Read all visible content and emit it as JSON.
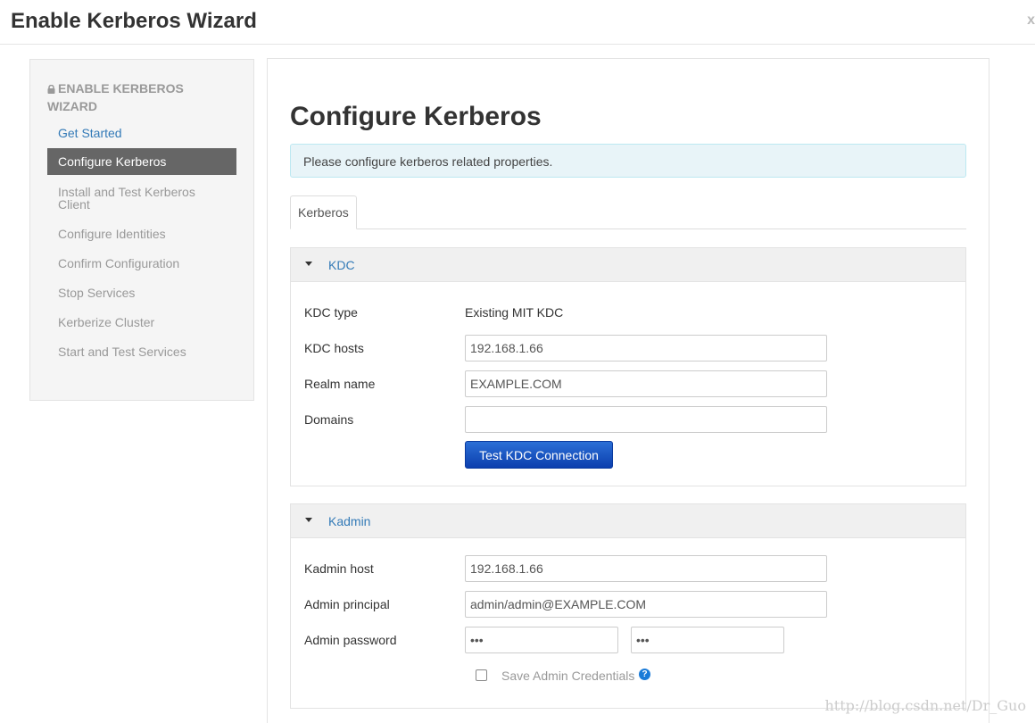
{
  "modal": {
    "title": "Enable Kerberos Wizard",
    "close_label": "x"
  },
  "sidebar": {
    "header": "ENABLE KERBEROS WIZARD",
    "items": [
      {
        "label": "Get Started",
        "state": "link"
      },
      {
        "label": "Configure Kerberos",
        "state": "active"
      },
      {
        "label": "Install and Test Kerberos Client",
        "state": "disabled"
      },
      {
        "label": "Configure Identities",
        "state": "disabled"
      },
      {
        "label": "Confirm Configuration",
        "state": "disabled"
      },
      {
        "label": "Stop Services",
        "state": "disabled"
      },
      {
        "label": "Kerberize Cluster",
        "state": "disabled"
      },
      {
        "label": "Start and Test Services",
        "state": "disabled"
      }
    ]
  },
  "main": {
    "title": "Configure Kerberos",
    "alert": "Please configure kerberos related properties.",
    "tabs": [
      {
        "label": "Kerberos"
      }
    ],
    "kdc_panel": {
      "title": "KDC",
      "kdc_type_label": "KDC type",
      "kdc_type_value": "Existing MIT KDC",
      "kdc_hosts_label": "KDC hosts",
      "kdc_hosts_value": "192.168.1.66",
      "realm_label": "Realm name",
      "realm_value": "EXAMPLE.COM",
      "domains_label": "Domains",
      "domains_value": "",
      "test_button": "Test KDC Connection"
    },
    "kadmin_panel": {
      "title": "Kadmin",
      "host_label": "Kadmin host",
      "host_value": "192.168.1.66",
      "principal_label": "Admin principal",
      "principal_value": "admin/admin@EXAMPLE.COM",
      "password_label": "Admin password",
      "password_value": "•••",
      "password_confirm_value": "•••",
      "save_credentials_label": "Save Admin Credentials",
      "help_glyph": "?"
    }
  },
  "watermark": "http://blog.csdn.net/Dr_Guo",
  "colors": {
    "link": "#337ab7",
    "active_nav": "#666666",
    "primary_button": "#0c3fae",
    "help_icon": "#1a7bd8"
  }
}
